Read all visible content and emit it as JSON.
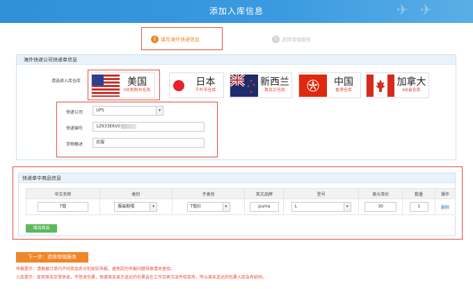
{
  "header": {
    "title": "添加入库信息"
  },
  "steps": [
    {
      "num": "1",
      "label": "填写海外快递信息"
    },
    {
      "num": "2",
      "label": "选择增值服务"
    }
  ],
  "courier_panel": {
    "title": "海外快递公司快递单信息",
    "warehouse_label": "请选择入库仓库",
    "warehouses": [
      {
        "name": "美国",
        "sub": "OR免税州仓库"
      },
      {
        "name": "日本",
        "sub": "千叶市仓库"
      },
      {
        "name": "新西兰",
        "sub": "奥克兰仓库"
      },
      {
        "name": "中国",
        "sub": "香港仓库"
      },
      {
        "name": "加拿大",
        "sub": "AB省仓库"
      }
    ],
    "company_label": "快递公司",
    "company_value": "UPS",
    "tracking_label": "快递编号",
    "tracking_value": "1Z933E6V0",
    "desc_label": "货物概述",
    "desc_value": "衣服"
  },
  "goods_panel": {
    "title": "快递单中商品信息",
    "columns": [
      "中文名称",
      "类别",
      "子类别",
      "英文品牌",
      "型号",
      "美元单价",
      "数量",
      "操作"
    ],
    "row": {
      "name": "T恤",
      "category": "服装鞋帽",
      "subcategory": "T恤衫",
      "brand": "puma",
      "model": "L",
      "price": "30",
      "qty": "1",
      "action": "删除"
    },
    "add_button": "增加商品"
  },
  "next_button": "下一步：选择增值服务",
  "notices": [
    "申报提示：请根据订单内不同货品名分别如实申报，避免因为申报问题导致清关查验。",
    "入库提示：库房周末正常休息，不签收包裹，快递周末显示送达的包裹会在工作日再次派件给库房，所以周末送达的包裹入库会有延时。"
  ],
  "colors": {
    "header": "#2f8fd8",
    "accent": "#f0862a",
    "alert": "#e14a3a",
    "add": "#5cb85c"
  }
}
